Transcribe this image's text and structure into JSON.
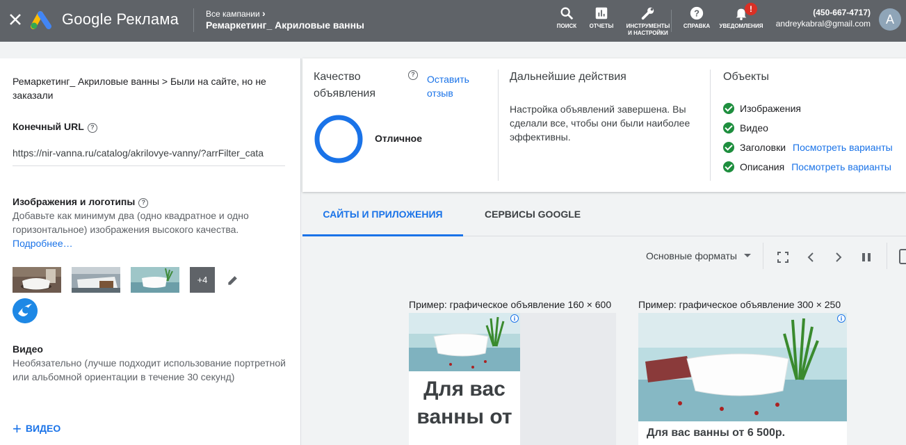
{
  "topbar": {
    "brand": "Google Реклама",
    "breadcrumb_top": "Все кампании",
    "breadcrumb_main": "Ремаркетинг_ Акриловые ванны",
    "tools": [
      {
        "label": "ПОИСК",
        "icon": "search-icon"
      },
      {
        "label": "ОТЧЕТЫ",
        "icon": "reports-icon"
      },
      {
        "label": "ИНСТРУМЕНТЫ И НАСТРОЙКИ",
        "icon": "wrench-icon"
      },
      {
        "label": "СПРАВКА",
        "icon": "help-icon"
      },
      {
        "label": "УВЕДОМЛЕНИЯ",
        "icon": "bell-icon"
      }
    ],
    "notification_badge": "!",
    "phone": "(450-667-4717)",
    "email": "andreykabral@gmail.com",
    "avatar_letter": "A"
  },
  "left": {
    "breadcrumb": "Ремаркетинг_ Акриловые ванны > Были на сайте, но не заказали",
    "final_url_title": "Конечный URL",
    "final_url_value": "https://nir-vanna.ru/catalog/akrilovye-vanny/?arrFilter_cata",
    "images_title": "Изображения и логотипы",
    "images_desc": "Добавьте как минимум два (одно квадратное и одно горизонтальное) изображения высокого качества.",
    "images_more": "Подробнее…",
    "thumbs_more": "+4",
    "video_title": "Видео",
    "video_desc": "Необязательно (лучше подходит использование портретной или альбомной ориентации в течение 30 секунд)",
    "add_video": "ВИДЕО"
  },
  "quality": {
    "title": "Качество объявления",
    "feedback": "Оставить отзыв",
    "rating": "Отличное"
  },
  "next_steps": {
    "title": "Дальнейшие действия",
    "text": "Настройка объявлений завершена. Вы сделали все, чтобы они были наиболее эффективны."
  },
  "objects": {
    "title": "Объекты",
    "items": [
      {
        "label": "Изображения",
        "link": ""
      },
      {
        "label": "Видео",
        "link": ""
      },
      {
        "label": "Заголовки",
        "link": "Посмотреть варианты"
      },
      {
        "label": "Описания",
        "link": "Посмотреть варианты"
      }
    ]
  },
  "tabs": [
    "САЙТЫ И ПРИЛОЖЕНИЯ",
    "СЕРВИСЫ GOOGLE"
  ],
  "preview": {
    "format_select": "Основные форматы",
    "label_1": "Пример: графическое объявление 160 × 600",
    "label_2": "Пример: графическое объявление 300 × 250",
    "ad1_headline": "Для вас ванны от",
    "ad2_headline": "Для вас ванны от 6 500р."
  },
  "colors": {
    "accent": "#1a73e8",
    "topbar": "#5f6368",
    "success": "#1e8e3e",
    "alert": "#d93025"
  }
}
